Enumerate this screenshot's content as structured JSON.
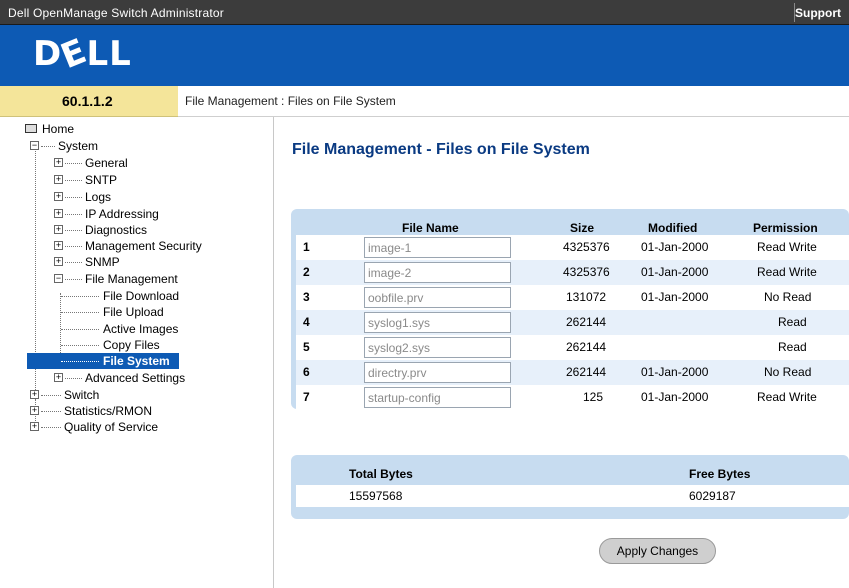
{
  "app_title": "Dell OpenManage Switch Administrator",
  "support_link": "Support",
  "logo_text": "D",
  "logo_text_e": "E",
  "logo_text_ll": "LL",
  "device_ip": "60.1.1.2",
  "breadcrumb": "File Management : Files on File System",
  "colors": {
    "banner": "#0d5ab4",
    "ip_bg": "#f4e59a",
    "table_bg": "#c7dcf0",
    "title": "#0a3a82"
  },
  "sidebar": {
    "home": "Home",
    "system": "System",
    "general": "General",
    "snmp_top": "SNTP",
    "logs": "Logs",
    "ip_addressing": "IP Addressing",
    "diagnostics": "Diagnostics",
    "management_security": "Management Security",
    "snmp": "SNMP",
    "file_management": "File Management",
    "file_download": "File Download",
    "file_upload": "File Upload",
    "active_images": "Active Images",
    "copy_files": "Copy Files",
    "file_system": "File System",
    "advanced_settings": "Advanced Settings",
    "switch": "Switch",
    "statistics": "Statistics/RMON",
    "qos": "Quality of Service"
  },
  "page_title": "File Management - Files on File System",
  "files_table": {
    "headers": {
      "name": "File Name",
      "size": "Size",
      "modified": "Modified",
      "permission": "Permission"
    },
    "rows": [
      {
        "num": "1",
        "name": "image-1",
        "size": "4325376",
        "modified": "01-Jan-2000",
        "permission": "Read Write"
      },
      {
        "num": "2",
        "name": "image-2",
        "size": "4325376",
        "modified": "01-Jan-2000",
        "permission": "Read Write"
      },
      {
        "num": "3",
        "name": "oobfile.prv",
        "size": "131072",
        "modified": "01-Jan-2000",
        "permission": "No Read"
      },
      {
        "num": "4",
        "name": "syslog1.sys",
        "size": "262144",
        "modified": "",
        "permission": "Read"
      },
      {
        "num": "5",
        "name": "syslog2.sys",
        "size": "262144",
        "modified": "",
        "permission": "Read"
      },
      {
        "num": "6",
        "name": "directry.prv",
        "size": "262144",
        "modified": "01-Jan-2000",
        "permission": "No Read"
      },
      {
        "num": "7",
        "name": "startup-config",
        "size": "125",
        "modified": "01-Jan-2000",
        "permission": "Read Write"
      }
    ]
  },
  "bytes_table": {
    "total_label": "Total Bytes",
    "free_label": "Free Bytes",
    "total_value": "15597568",
    "free_value": "6029187"
  },
  "apply_button": "Apply Changes"
}
